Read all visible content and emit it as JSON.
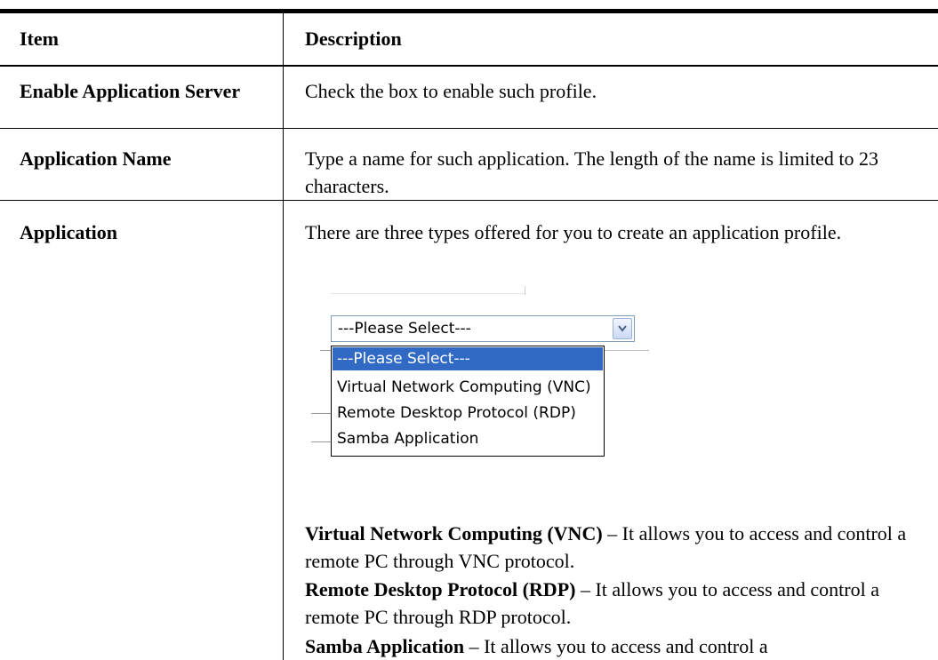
{
  "header": {
    "item": "Item",
    "description": "Description"
  },
  "rows": [
    {
      "item": "Enable Application Server",
      "description": "Check the box to enable such profile."
    },
    {
      "item": "Application Name",
      "description": "Type a name for such application. The length of the name is limited to 23 characters."
    },
    {
      "item": "Application",
      "description": "There are three types offered for you to create an application profile."
    }
  ],
  "select": {
    "value": "---Please Select---",
    "options": [
      "---Please Select---",
      "Virtual Network Computing (VNC)",
      "Remote Desktop Protocol (RDP)",
      "Samba Application"
    ],
    "highlighted_index": 0,
    "highlight_color": "#316ac5"
  },
  "definitions": [
    {
      "term": "Virtual Network Computing (VNC)",
      "text": " – It allows you to access and control a remote PC through VNC protocol."
    },
    {
      "term": "Remote Desktop Protocol (RDP)",
      "text": " – It allows you to access and control a remote PC through RDP protocol."
    },
    {
      "term": "Samba Application",
      "text": " – It allows you to access and control a"
    }
  ]
}
